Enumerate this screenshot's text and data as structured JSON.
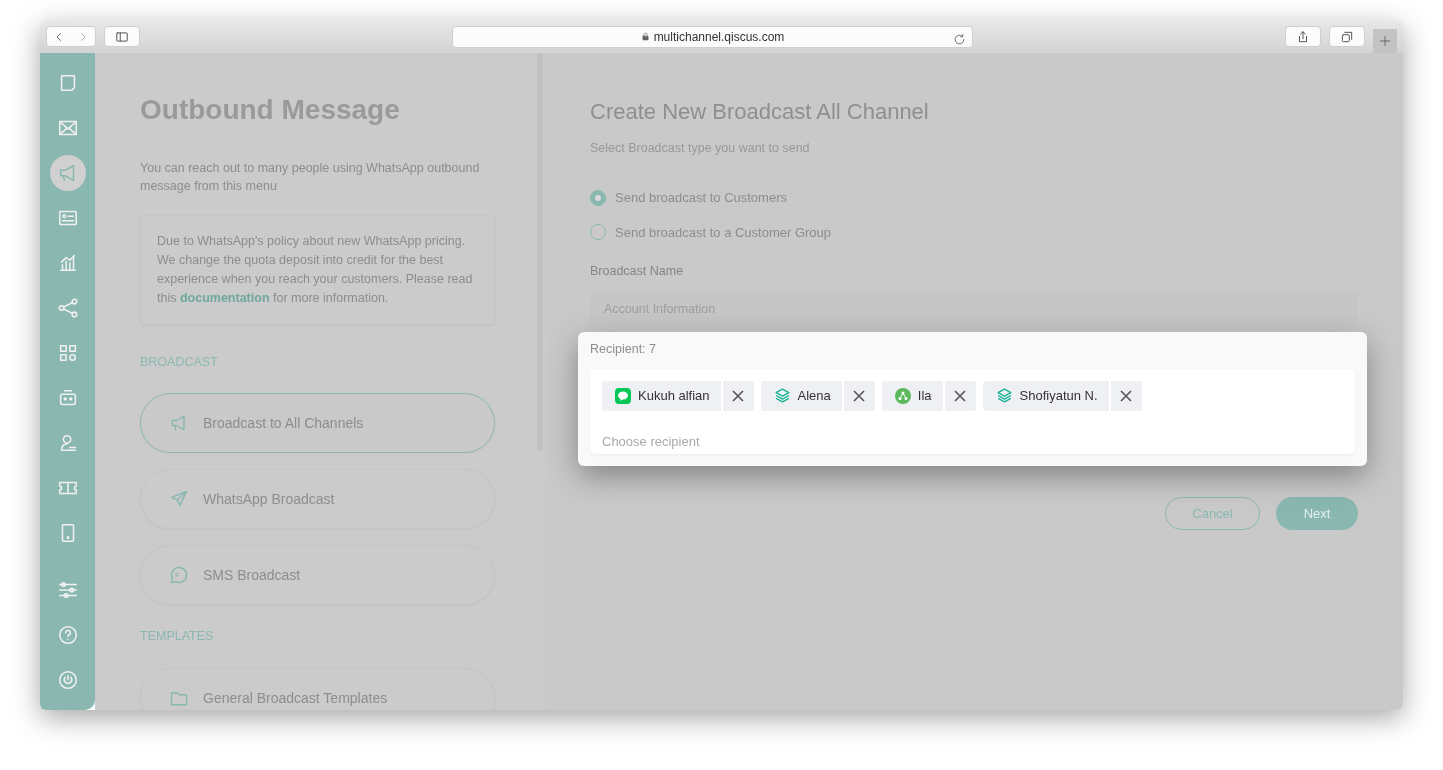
{
  "browser": {
    "url": "multichannel.qiscus.com"
  },
  "sidebar": {
    "items": [
      {
        "selected": false
      },
      {
        "selected": false
      },
      {
        "selected": true
      },
      {
        "selected": false
      },
      {
        "selected": false
      },
      {
        "selected": false
      },
      {
        "selected": false
      },
      {
        "selected": false
      },
      {
        "selected": false
      },
      {
        "selected": false
      },
      {
        "selected": false
      },
      {
        "selected": false
      },
      {
        "selected": false
      },
      {
        "selected": false
      }
    ]
  },
  "left_panel": {
    "title": "Outbound Message",
    "description": "You can reach out to many people using WhatsApp outbound message from this menu",
    "notice": "Due to WhatsApp's policy about new WhatsApp pricing. We change the quota deposit into credit for the best experience when you reach your customers. Please read this **documentation** for more information.",
    "sections": [
      {
        "heading": "BROADCAST",
        "items": [
          {
            "label": "Broadcast to All Channels",
            "kind": "megaphone",
            "selected": true
          },
          {
            "label": "WhatsApp Broadcast",
            "kind": "send",
            "selected": false
          },
          {
            "label": "SMS Broadcast",
            "kind": "chat",
            "selected": false
          }
        ]
      },
      {
        "heading": "TEMPLATES",
        "items": [
          {
            "label": "General Broadcast Templates",
            "kind": "folder",
            "selected": false
          }
        ]
      }
    ]
  },
  "form": {
    "title": "Create New Broadcast All Channel",
    "subtitle": "Select Broadcast type you want to send",
    "options": [
      {
        "label": "Send broadcast to Customers",
        "selected": true
      },
      {
        "label": "Send broadcast to a Customer Group",
        "selected": false
      }
    ],
    "name_label": "Broadcast Name",
    "name_value": "Account Information",
    "recipient": {
      "label": "Recipient: 7",
      "placeholder": "Choose recipient",
      "chips": [
        {
          "name": "Kukuh alfian",
          "kind": "line"
        },
        {
          "name": "Alena",
          "kind": "group"
        },
        {
          "name": "Ila",
          "kind": "widget"
        },
        {
          "name": "Shofiyatun N.",
          "kind": "group"
        }
      ]
    },
    "buttons": [
      {
        "label": "Cancel",
        "kind": "secondary"
      },
      {
        "label": "Next",
        "kind": "primary"
      }
    ]
  }
}
